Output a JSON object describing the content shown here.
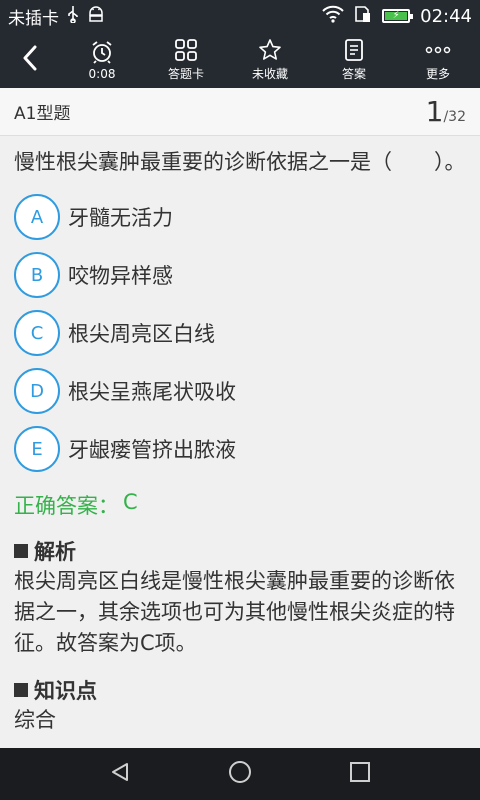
{
  "status_bar": {
    "carrier": "未插卡",
    "time": "02:44"
  },
  "toolbar": {
    "timer_label": "0:08",
    "card_label": "答题卡",
    "favorite_label": "未收藏",
    "answer_label": "答案",
    "more_label": "更多"
  },
  "question": {
    "type": "A1型题",
    "current": "1",
    "total": "/32",
    "stem": "慢性根尖囊肿最重要的诊断依据之一是（　　）。",
    "options": [
      {
        "letter": "A",
        "text": "牙髓无活力"
      },
      {
        "letter": "B",
        "text": "咬物异样感"
      },
      {
        "letter": "C",
        "text": "根尖周亮区白线"
      },
      {
        "letter": "D",
        "text": "根尖呈燕尾状吸收"
      },
      {
        "letter": "E",
        "text": "牙龈瘘管挤出脓液"
      }
    ],
    "answer_label": "正确答案：",
    "answer_value": "C"
  },
  "analysis": {
    "title": "解析",
    "text": "根尖周亮区白线是慢性根尖囊肿最重要的诊断依据之一，其余选项也可为其他慢性根尖炎症的特征。故答案为C项。"
  },
  "knowledge": {
    "title": "知识点",
    "text": "综合"
  },
  "colors": {
    "bar": "#252a30",
    "accent": "#2f9be0",
    "correct": "#34b24a"
  },
  "icons": [
    "usb-icon",
    "android-icon",
    "wifi-icon",
    "sim-icon",
    "battery-icon",
    "back-arrow-icon",
    "alarm-clock-icon",
    "grid-icon",
    "star-icon",
    "document-icon",
    "more-dots-icon",
    "nav-back-icon",
    "nav-home-icon",
    "nav-recent-icon"
  ]
}
